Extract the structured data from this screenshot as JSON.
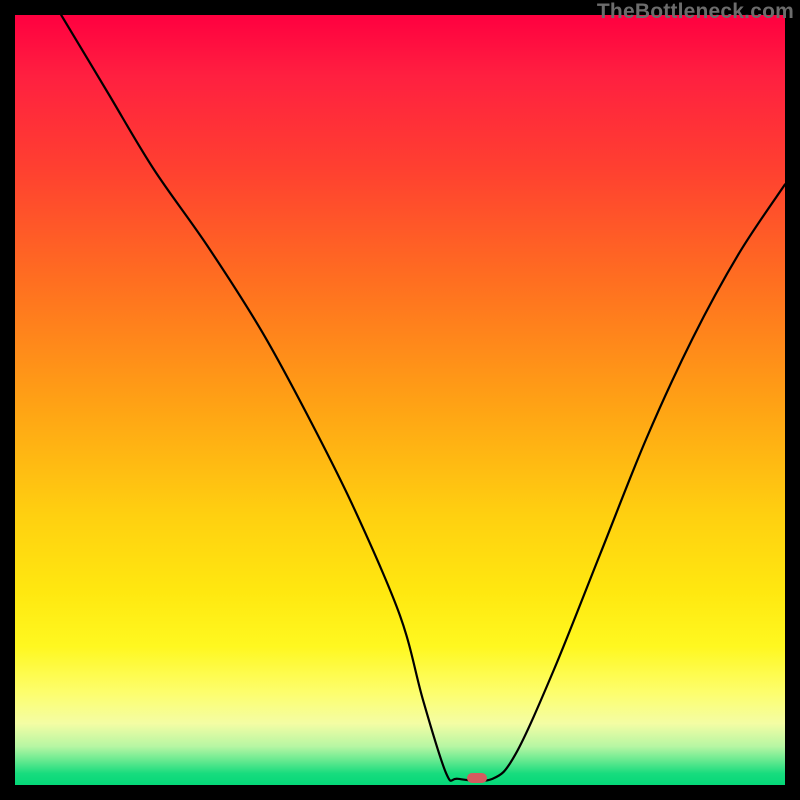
{
  "watermark": "TheBottleneck.com",
  "chart_data": {
    "type": "line",
    "title": "",
    "xlabel": "",
    "ylabel": "",
    "xlim": [
      0,
      100
    ],
    "ylim": [
      0,
      100
    ],
    "series": [
      {
        "name": "curve",
        "x": [
          6,
          12,
          18,
          25,
          32,
          38,
          44,
          50,
          53,
          56,
          57.5,
          62,
          65,
          70,
          76,
          82,
          88,
          94,
          100
        ],
        "values": [
          100,
          90,
          80,
          70,
          59,
          48,
          36,
          22,
          11,
          1.5,
          0.8,
          0.8,
          4,
          15,
          30,
          45,
          58,
          69,
          78
        ]
      }
    ],
    "marker": {
      "x_percent": 60,
      "y_percent": 0.9
    },
    "gradient_note": "vertical red-to-green gradient background, black border"
  }
}
